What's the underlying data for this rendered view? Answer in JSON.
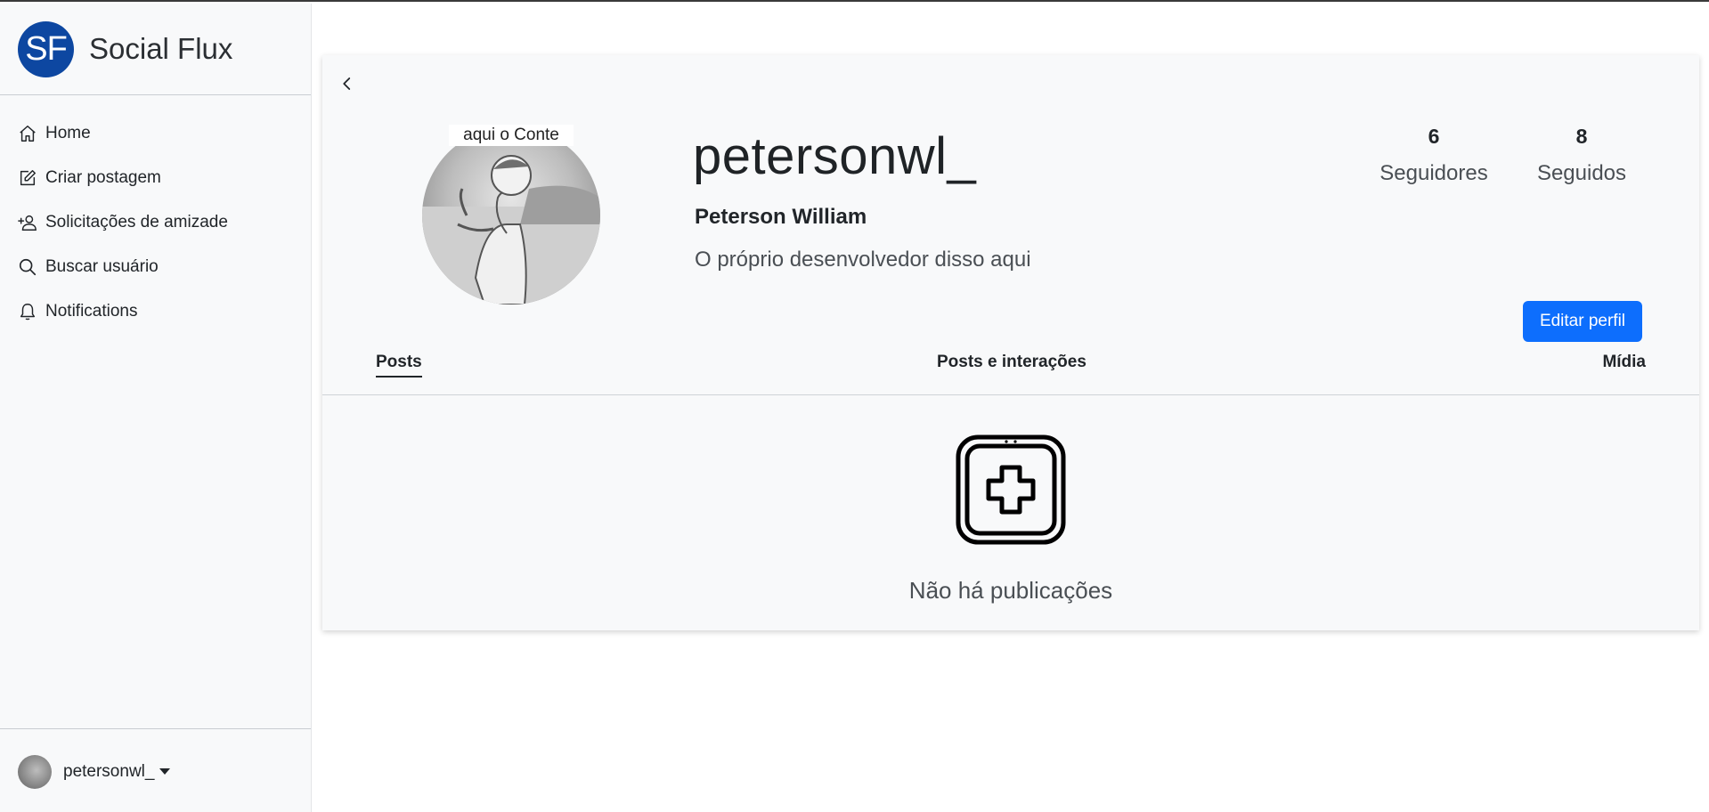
{
  "brand": {
    "logo_text": "SF",
    "name": "Social Flux",
    "logo_color": "#0d47a1"
  },
  "nav": {
    "items": [
      {
        "label": "Home",
        "icon": "home-icon"
      },
      {
        "label": "Criar postagem",
        "icon": "edit-square-icon"
      },
      {
        "label": "Solicitações de amizade",
        "icon": "person-plus-icon"
      },
      {
        "label": "Buscar usuário",
        "icon": "search-icon"
      },
      {
        "label": "Notifications",
        "icon": "bell-icon"
      }
    ]
  },
  "footer": {
    "username": "petersonwl_"
  },
  "profile": {
    "avatar_caption": "aqui o Conte",
    "username": "petersonwl_",
    "full_name": "Peterson William",
    "bio": "O próprio desenvolvedor disso aqui",
    "followers_count": "6",
    "followers_label": "Seguidores",
    "following_count": "8",
    "following_label": "Seguidos",
    "edit_button": "Editar perfil"
  },
  "tabs": {
    "posts": "Posts",
    "posts_interactions": "Posts e interações",
    "media": "Mídia",
    "active": "posts"
  },
  "empty_state": {
    "icon": "add-post-icon",
    "text": "Não há publicações"
  },
  "colors": {
    "accent": "#0d6efd",
    "background": "#f8f9fa"
  }
}
